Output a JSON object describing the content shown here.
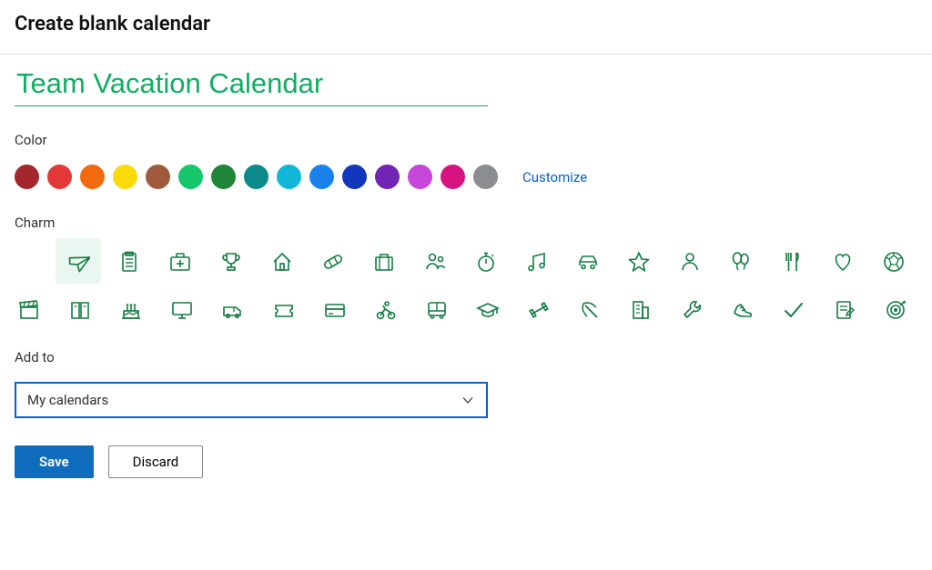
{
  "title": "Create blank calendar",
  "calendar_name": "Team Vacation Calendar",
  "section_color_label": "Color",
  "section_charm_label": "Charm",
  "section_addto_label": "Add to",
  "colors": [
    {
      "name": "dark-red",
      "hex": "#a3272c"
    },
    {
      "name": "red",
      "hex": "#e23838"
    },
    {
      "name": "orange",
      "hex": "#f26a0f"
    },
    {
      "name": "yellow",
      "hex": "#fcd90b"
    },
    {
      "name": "brown",
      "hex": "#9e5a3b"
    },
    {
      "name": "bright-green",
      "hex": "#15c66b"
    },
    {
      "name": "green",
      "hex": "#1e8637"
    },
    {
      "name": "teal",
      "hex": "#0c8a8a"
    },
    {
      "name": "cyan",
      "hex": "#12b6d6"
    },
    {
      "name": "blue",
      "hex": "#1a82ec"
    },
    {
      "name": "navy",
      "hex": "#1337bc"
    },
    {
      "name": "purple",
      "hex": "#7224b4"
    },
    {
      "name": "magenta",
      "hex": "#c646d9"
    },
    {
      "name": "pink",
      "hex": "#d61381"
    },
    {
      "name": "grey",
      "hex": "#8b8d91"
    }
  ],
  "customize_label": "Customize",
  "selected_color_index": 5,
  "charms_row1": [
    "airplane",
    "clipboard",
    "first-aid",
    "trophy",
    "home",
    "band-aid",
    "briefcase",
    "people",
    "stopwatch",
    "music",
    "car",
    "star",
    "person",
    "balloons",
    "utensils",
    "heart",
    "soccer"
  ],
  "charms_row2": [
    "clapperboard",
    "book",
    "cake",
    "monitor",
    "van",
    "ticket",
    "credit-card",
    "cyclist",
    "bus",
    "graduation",
    "dumbbell",
    "pickaxe",
    "building",
    "wrench",
    "running-shoe",
    "checkmark",
    "notebook-edit",
    "target"
  ],
  "selected_charm": "airplane",
  "addto_value": "My calendars",
  "save_label": "Save",
  "discard_label": "Discard"
}
